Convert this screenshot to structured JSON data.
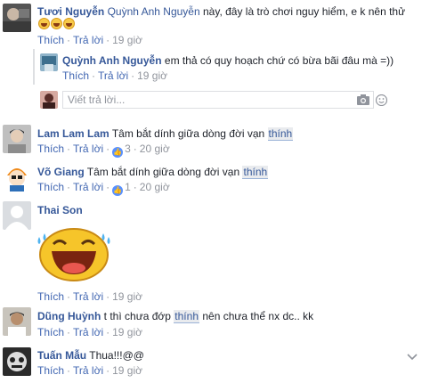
{
  "comments": [
    {
      "author": "Tươi Nguyễn",
      "mention": "Quỳnh Anh Nguyễn",
      "text": "này, đây là trò chơi nguy hiểm, e k nên thử",
      "emoji_count": 3,
      "actions": {
        "like": "Thích",
        "reply": "Trả lời",
        "time": "19 giờ"
      },
      "reply": {
        "author": "Quỳnh Anh Nguyễn",
        "text": "em thả có quy hoạch chứ có bừa bãi đâu mà =))",
        "actions": {
          "like": "Thích",
          "reply": "Trả lời",
          "time": "19 giờ"
        }
      },
      "reply_input": {
        "placeholder": "Viết trả lời..."
      }
    },
    {
      "author": "Lam Lam Lam",
      "text": "Tâm bắt dính giữa dòng đời vạn",
      "tag": "thính",
      "actions": {
        "like": "Thích",
        "reply": "Trả lời",
        "like_count": "3",
        "time": "20 giờ"
      }
    },
    {
      "author": "Võ Giang",
      "text": "Tâm bắt dính giữa dòng đời vạn",
      "tag": "thính",
      "actions": {
        "like": "Thích",
        "reply": "Trả lời",
        "like_count": "1",
        "time": "20 giờ"
      }
    },
    {
      "author": "Thai Son",
      "sticker": "laughing-face-sticker",
      "actions": {
        "like": "Thích",
        "reply": "Trả lời",
        "time": "19 giờ"
      }
    },
    {
      "author": "Dũng Huỳnh",
      "text_before": "t thì chưa đớp",
      "tag": "thính",
      "text_after": "nên chưa thể nx dc.. kk",
      "actions": {
        "like": "Thích",
        "reply": "Trả lời",
        "time": "19 giờ"
      }
    },
    {
      "author": "Tuấn Mẫu",
      "text": "Thua!!!@@",
      "actions": {
        "like": "Thích",
        "reply": "Trả lời",
        "time": "19 giờ"
      }
    }
  ],
  "colors": {
    "link": "#365899",
    "action": "#4267b2",
    "meta": "#90949c",
    "like_badge": "#5890ff"
  }
}
